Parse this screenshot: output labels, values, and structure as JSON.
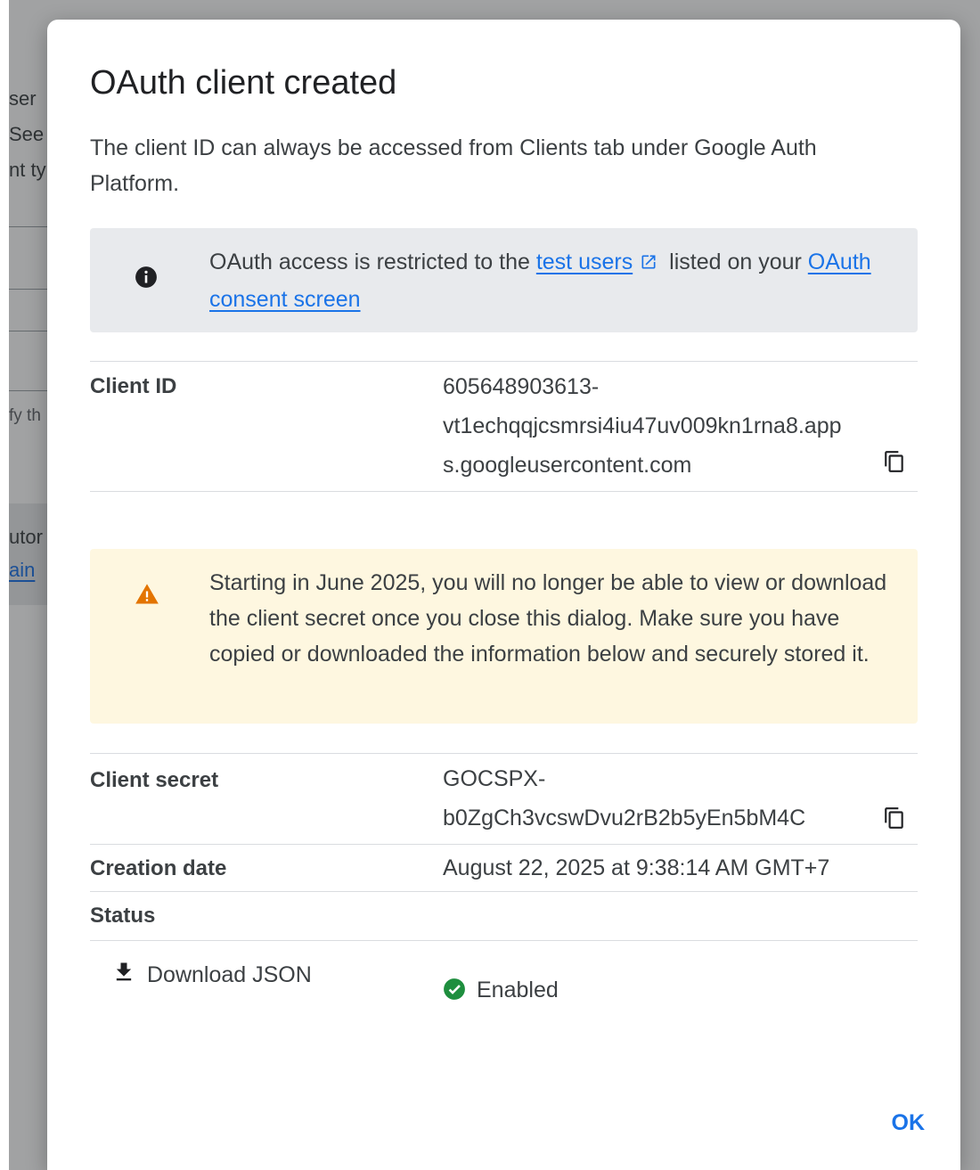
{
  "background": {
    "fragments": [
      "ser",
      "See",
      "nt ty",
      "fy th",
      "utor",
      "ain"
    ]
  },
  "dialog": {
    "title": "OAuth client created",
    "description": "The client ID can always be accessed from Clients tab under Google Auth Platform.",
    "info_banner": {
      "icon": "info-icon",
      "text_before": "OAuth access is restricted to the ",
      "test_users_link": "test users",
      "text_middle": " listed on your ",
      "consent_link": "OAuth consent screen"
    },
    "client_id": {
      "label": "Client ID",
      "value": "605648903613-\nvt1echqqjcsmrsi4iu47uv009kn1rna8.app\ns.googleusercontent.com"
    },
    "warning_banner": {
      "icon": "warning-icon",
      "text": "Starting in June 2025, you will no longer be able to view or download the client secret once you close this dialog. Make sure you have copied or downloaded the information below and securely stored it."
    },
    "client_secret": {
      "label": "Client secret",
      "value": "GOCSPX-\nb0ZgCh3vcswDvu2rB2b5yEn5bM4C"
    },
    "creation_date": {
      "label": "Creation date",
      "value": "August 22, 2025 at 9:38:14 AM GMT+7"
    },
    "status": {
      "label": "Status",
      "value": "Enabled",
      "color": "#1e8e3e"
    },
    "download_label": "Download JSON",
    "ok_label": "OK"
  },
  "colors": {
    "accent": "#1a73e8",
    "warning": "#e37400",
    "info_banner_bg": "#e8eaed",
    "warning_banner_bg": "#fef7e0"
  }
}
